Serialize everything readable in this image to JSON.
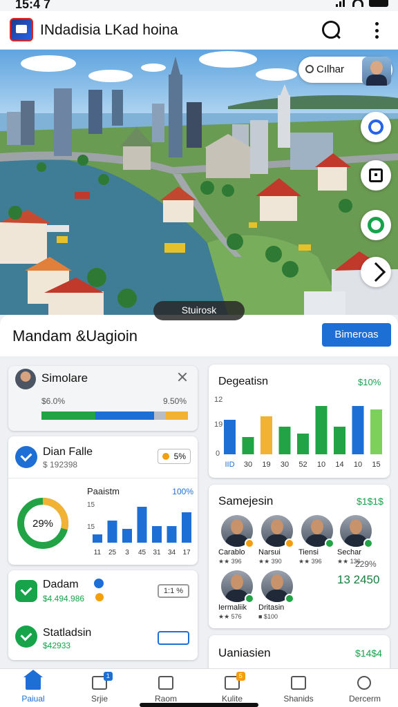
{
  "status_bar": {
    "time": "15:4 7"
  },
  "app_bar": {
    "title": "INdadisia LKad hoina"
  },
  "map": {
    "profile_label": "Cılhar",
    "tag": "Stuirosk",
    "fabs": [
      "link-icon",
      "bag-icon",
      "ring-icon",
      "route-icon"
    ]
  },
  "sheet": {
    "title": "Mandam &Uagioin",
    "action_button": "Bimeroas"
  },
  "simolare_card": {
    "title": "Simolare",
    "left_value": "$6.0%",
    "right_value": "9.50%",
    "progress_segments": [
      {
        "fraction": 0.37,
        "color": "#22a345"
      },
      {
        "fraction": 0.4,
        "color": "#1d6fd6"
      },
      {
        "fraction": 0.08,
        "color": "#b8bcc4"
      },
      {
        "fraction": 0.15,
        "color": "#f2b233"
      }
    ]
  },
  "dian_card": {
    "title": "Dian Falle",
    "subtitle": "$ 192398",
    "badge": "5%",
    "donut_value": "29%",
    "donut_fraction": 0.29,
    "chart_data": {
      "type": "bar",
      "title": "Paaistm",
      "badge": "100%",
      "ytick": "15",
      "ytick2": "15",
      "categories": [
        "11",
        "25",
        "3",
        "45",
        "31",
        "34",
        "17"
      ],
      "values": [
        3,
        8,
        5,
        13,
        6,
        6,
        11
      ],
      "ylim": [
        0,
        14
      ],
      "color": "#1d6fd6"
    }
  },
  "dadam_rows": [
    {
      "title": "Dadam",
      "value": "$4.494.986",
      "chip": "1:1 %"
    },
    {
      "title": "Statladsin",
      "value": "$42933",
      "chip": ""
    }
  ],
  "degeatisn_card": {
    "chart_data": {
      "type": "bar",
      "title": "Degeatisn",
      "badge": "$10%",
      "yticks": [
        "12",
        "19",
        "0"
      ],
      "categories": [
        "IID",
        "30",
        "19",
        "30",
        "52",
        "10",
        "14",
        "10",
        "15"
      ],
      "values": [
        10,
        5,
        11,
        8,
        6,
        14,
        8,
        14,
        13
      ],
      "colors": [
        "#1d6fd6",
        "#22a345",
        "#f2b233",
        "#22a345",
        "#22a345",
        "#22a345",
        "#22a345",
        "#1d6fd6",
        "#7dd05a"
      ],
      "ylim": [
        0,
        16
      ]
    }
  },
  "samejesin_card": {
    "title": "Samejesin",
    "amount": "$1$1$",
    "people": [
      {
        "name": "Carablo",
        "rating": "★★ 396",
        "badge_color": "#f59e0b"
      },
      {
        "name": "Narsui",
        "rating": "★★ 390",
        "badge_color": "#f59e0b"
      },
      {
        "name": "Tiensi",
        "rating": "★★ 396",
        "badge_color": "#22a345"
      },
      {
        "name": "Sechar",
        "rating": "★★ 136",
        "badge_color": "#22a345"
      },
      {
        "name": "Iermaliik",
        "rating": "★★ 576",
        "badge_color": "#22a345"
      },
      {
        "name": "Dritasin",
        "rating": "■ $100",
        "badge_color": "#22a345"
      }
    ],
    "percent": "229%",
    "total": "13 2450"
  },
  "uaniasien_card": {
    "title": "Uaniasien",
    "amount": "$14$4"
  },
  "bottom_nav": [
    {
      "label": "Paiual",
      "active": true,
      "badge": ""
    },
    {
      "label": "Srjie",
      "active": false,
      "badge": "1"
    },
    {
      "label": "Raom",
      "active": false,
      "badge": ""
    },
    {
      "label": "Kulite",
      "active": false,
      "badge": "5"
    },
    {
      "label": "Shanids",
      "active": false,
      "badge": ""
    },
    {
      "label": "Dercerm",
      "active": false,
      "badge": ""
    }
  ]
}
